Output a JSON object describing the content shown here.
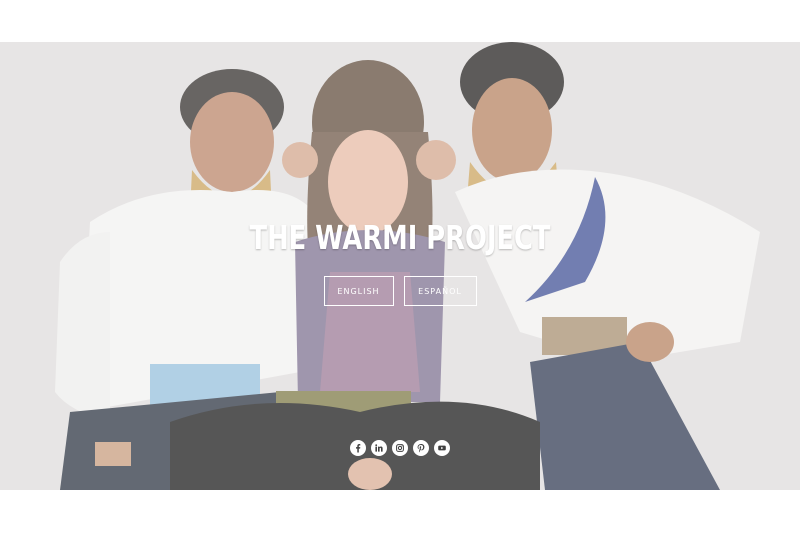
{
  "hero": {
    "title": "THE WARMI PROJECT",
    "languages": [
      {
        "label": "ENGLISH"
      },
      {
        "label": "ESPAÑOL"
      }
    ]
  },
  "social": [
    "facebook-icon",
    "linkedin-icon",
    "instagram-icon",
    "pinterest-icon",
    "youtube-icon"
  ],
  "colors": {
    "page_bg": "#ffffff",
    "hero_bg": "#dcdad9",
    "text": "#ffffff",
    "icon": "#404040"
  }
}
